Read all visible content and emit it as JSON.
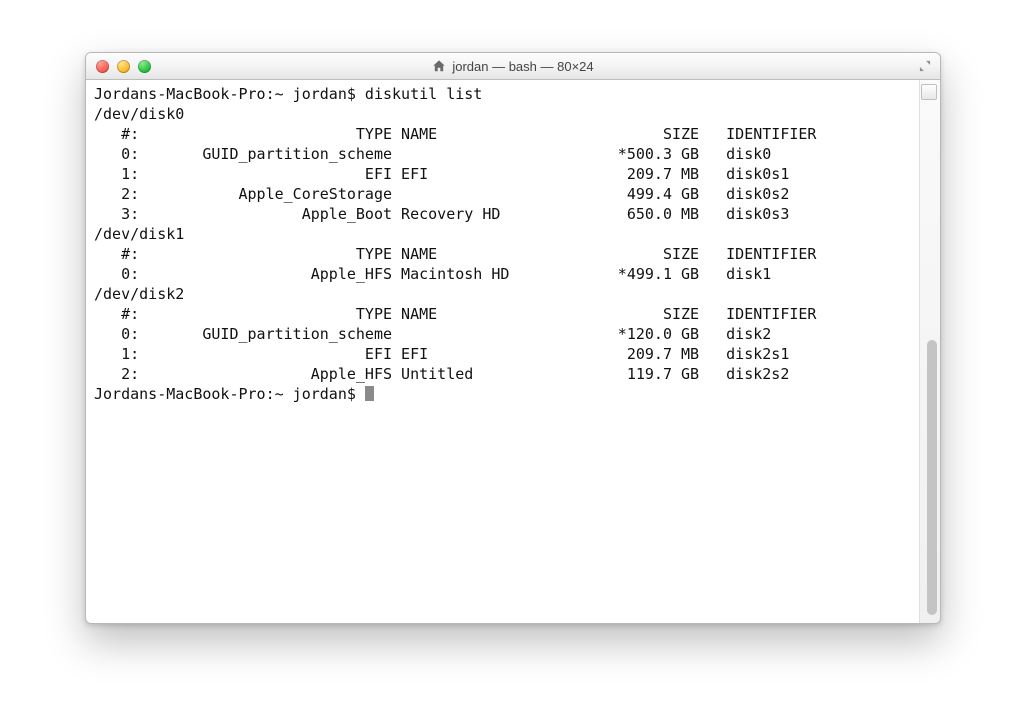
{
  "window": {
    "title": "jordan — bash — 80×24"
  },
  "terminal": {
    "prompt": "Jordans-MacBook-Pro:~ jordan$",
    "command": "diskutil list",
    "disks": [
      {
        "device": "/dev/disk0",
        "header": {
          "num": "#:",
          "type": "TYPE",
          "name": "NAME",
          "size": "SIZE",
          "identifier": "IDENTIFIER"
        },
        "rows": [
          {
            "num": "0:",
            "type": "GUID_partition_scheme",
            "name": "",
            "size": "*500.3 GB",
            "identifier": "disk0"
          },
          {
            "num": "1:",
            "type": "EFI",
            "name": "EFI",
            "size": "209.7 MB",
            "identifier": "disk0s1"
          },
          {
            "num": "2:",
            "type": "Apple_CoreStorage",
            "name": "",
            "size": "499.4 GB",
            "identifier": "disk0s2"
          },
          {
            "num": "3:",
            "type": "Apple_Boot",
            "name": "Recovery HD",
            "size": "650.0 MB",
            "identifier": "disk0s3"
          }
        ]
      },
      {
        "device": "/dev/disk1",
        "header": {
          "num": "#:",
          "type": "TYPE",
          "name": "NAME",
          "size": "SIZE",
          "identifier": "IDENTIFIER"
        },
        "rows": [
          {
            "num": "0:",
            "type": "Apple_HFS",
            "name": "Macintosh HD",
            "size": "*499.1 GB",
            "identifier": "disk1"
          }
        ]
      },
      {
        "device": "/dev/disk2",
        "header": {
          "num": "#:",
          "type": "TYPE",
          "name": "NAME",
          "size": "SIZE",
          "identifier": "IDENTIFIER"
        },
        "rows": [
          {
            "num": "0:",
            "type": "GUID_partition_scheme",
            "name": "",
            "size": "*120.0 GB",
            "identifier": "disk2"
          },
          {
            "num": "1:",
            "type": "EFI",
            "name": "EFI",
            "size": "209.7 MB",
            "identifier": "disk2s1"
          },
          {
            "num": "2:",
            "type": "Apple_HFS",
            "name": "Untitled",
            "size": "119.7 GB",
            "identifier": "disk2s2"
          }
        ]
      }
    ]
  },
  "icons": {
    "home": "home-icon",
    "expand": "expand-icon"
  }
}
